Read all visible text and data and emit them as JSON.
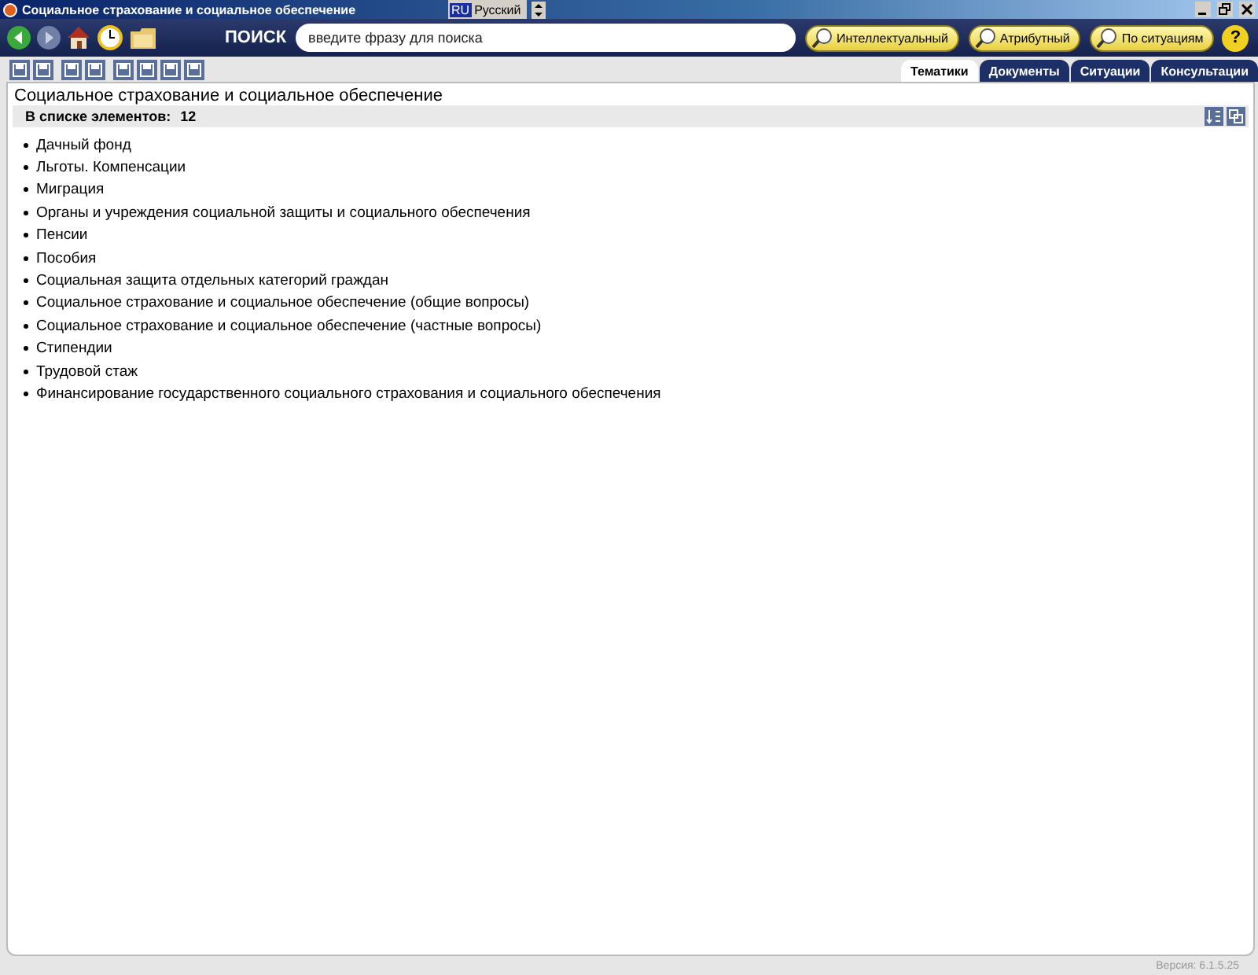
{
  "window": {
    "title": "Социальное страхование и социальное обеспечение",
    "language_code": "RU",
    "language": "Русский"
  },
  "search": {
    "label": "ПОИСК",
    "placeholder": "введите фразу для поиска",
    "buttons": [
      "Интеллектуальный",
      "Атрибутный",
      "По ситуациям"
    ],
    "help": "?"
  },
  "tabs": [
    {
      "label": "Тематики",
      "selected": true
    },
    {
      "label": "Документы",
      "selected": false
    },
    {
      "label": "Ситуации",
      "selected": false
    },
    {
      "label": "Консультации",
      "selected": false
    }
  ],
  "heading": "Социальное страхование и социальное обеспечение",
  "count": {
    "label": "В списке элементов:",
    "value": "12"
  },
  "items": [
    "Дачный фонд",
    "Льготы. Компенсации",
    "Миграция",
    "Органы и учреждения социальной защиты и социального обеспечения",
    "Пенсии",
    "Пособия",
    "Социальная защита отдельных категорий граждан",
    "Социальное страхование и социальное обеспечение (общие вопросы)",
    "Социальное страхование и социальное обеспечение (частные вопросы)",
    "Стипендии",
    "Трудовой стаж",
    "Финансирование государственного социального страхования и социального обеспечения"
  ],
  "version": "Версия: 6.1.5.25"
}
